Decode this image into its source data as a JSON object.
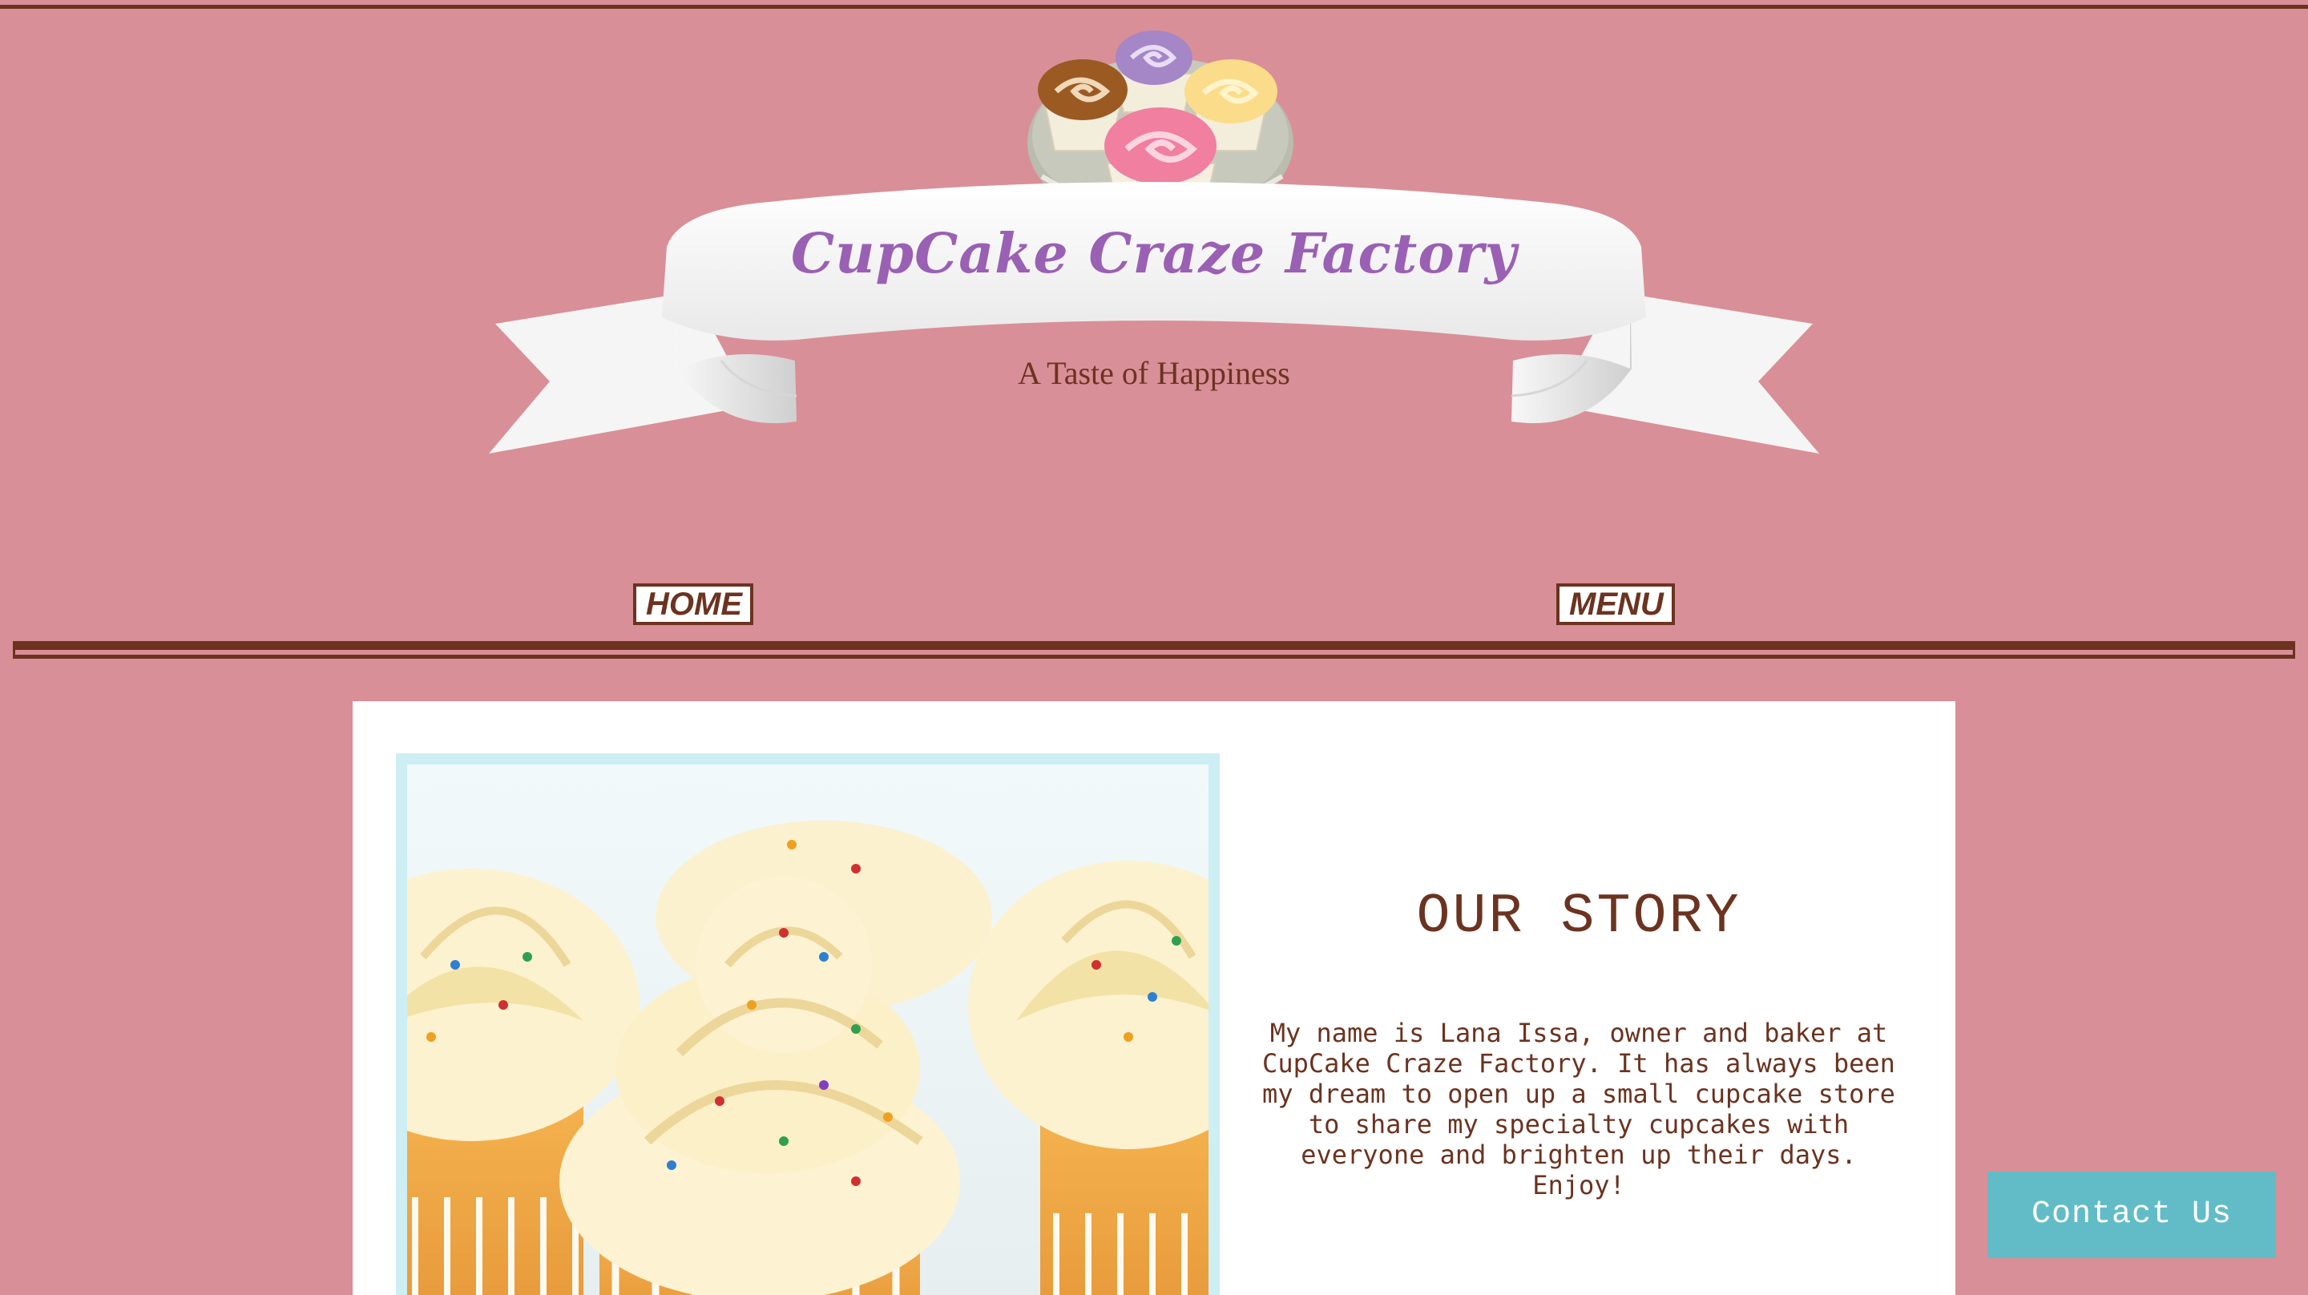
{
  "header": {
    "title": "CupCake Craze Factory",
    "tagline": "A Taste of Happiness"
  },
  "nav": {
    "items": [
      {
        "label": "HOME"
      },
      {
        "label": "MENU"
      }
    ]
  },
  "story": {
    "heading": "OUR STORY",
    "body": "My name is Lana Issa, owner and baker at\nCupCake Craze Factory. It has always been\nmy dream to open up a small cupcake store\nto share my specialty cupcakes with\neveryone and brighten up their days.\nEnjoy!"
  },
  "contact": {
    "label": "Contact Us"
  },
  "colors": {
    "background": "#d98f97",
    "accent_brown": "#6b3320",
    "title_purple": "#9a60b3",
    "contact_teal": "#62bcc7"
  }
}
